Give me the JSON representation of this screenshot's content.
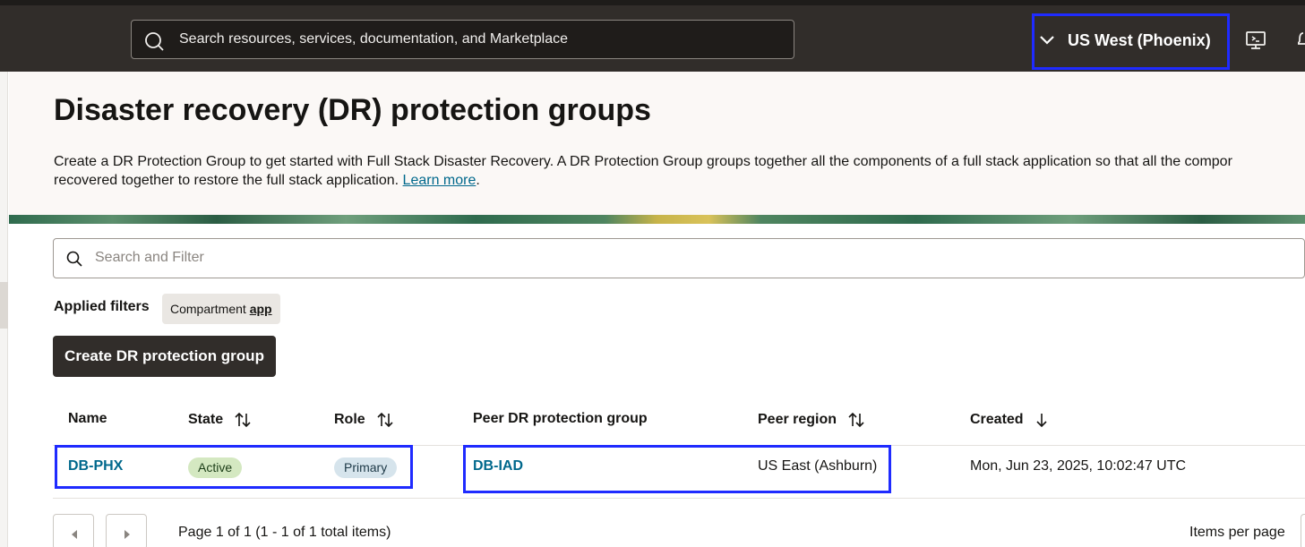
{
  "topbar": {
    "search_placeholder": "Search resources, services, documentation, and Marketplace",
    "region_label": "US West (Phoenix)"
  },
  "header": {
    "title": "Disaster recovery (DR) protection groups",
    "description_line1": "Create a DR Protection Group to get started with Full Stack Disaster Recovery. A DR Protection Group groups together all the components of a full stack application so that all the compor",
    "description_line2_prefix": "recovered together to restore the full stack application. ",
    "learn_more": "Learn more",
    "description_line2_suffix": "."
  },
  "filter": {
    "placeholder": "Search and Filter",
    "applied_label": "Applied filters",
    "chip_key": "Compartment",
    "chip_value": "app"
  },
  "create_button": "Create DR protection group",
  "table": {
    "columns": [
      "Name",
      "State",
      "Role",
      "Peer DR protection group",
      "Peer region",
      "Created"
    ],
    "rows": [
      {
        "name": "DB-PHX",
        "state": "Active",
        "role": "Primary",
        "peer_group": "DB-IAD",
        "peer_region": "US East (Ashburn)",
        "created": "Mon, Jun 23, 2025, 10:02:47 UTC"
      }
    ]
  },
  "pagination": {
    "summary": "Page 1 of 1 (1 - 1 of 1 total items)",
    "items_per_page_label": "Items per page"
  },
  "colors": {
    "topbar": "#312d2a",
    "highlight": "#1f2bff",
    "link": "#00688c",
    "active_badge": "#d4e8c1",
    "primary_badge": "#d6e4ec"
  }
}
